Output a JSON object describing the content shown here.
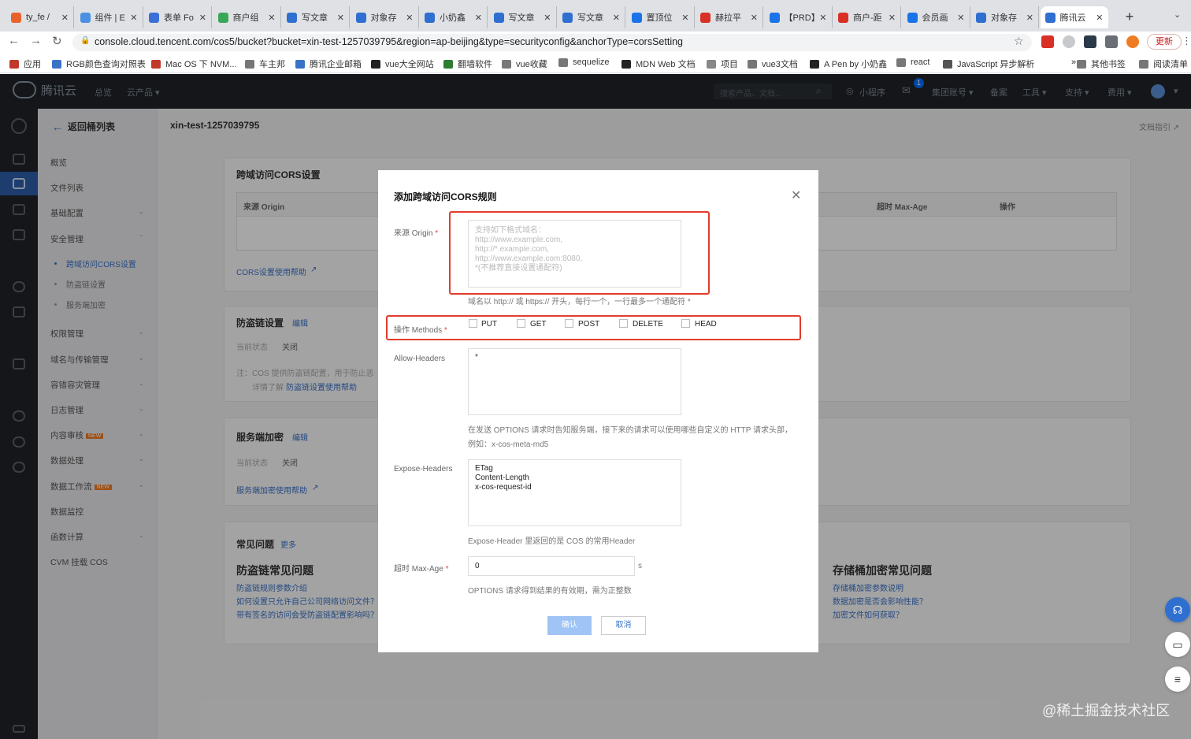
{
  "browser": {
    "tabs": [
      {
        "title": "ty_fe /",
        "color": "#e8632b"
      },
      {
        "title": "组件 | E",
        "color": "#4a90e2"
      },
      {
        "title": "表单 Fo",
        "color": "#3b6fd8"
      },
      {
        "title": "商户组",
        "color": "#3aa757"
      },
      {
        "title": "写文章",
        "color": "#2f6fd0"
      },
      {
        "title": "对象存",
        "color": "#2f6fd0"
      },
      {
        "title": "小奶鑫",
        "color": "#2f6fd0"
      },
      {
        "title": "写文章",
        "color": "#2f6fd0"
      },
      {
        "title": "写文章",
        "color": "#2f6fd0"
      },
      {
        "title": "置顶位",
        "color": "#1a73e8"
      },
      {
        "title": "赫拉平",
        "color": "#d93025"
      },
      {
        "title": "【PRD】",
        "color": "#1a73e8"
      },
      {
        "title": "商户-距",
        "color": "#d93025"
      },
      {
        "title": "会员画",
        "color": "#1a73e8"
      },
      {
        "title": "对象存",
        "color": "#2f6fd0"
      },
      {
        "title": "腾讯云",
        "color": "#2f6fd0"
      }
    ],
    "new_tab": "+",
    "url": "console.cloud.tencent.com/cos5/bucket?bucket=xin-test-1257039795&region=ap-beijing&type=securityconfig&anchorType=corsSetting",
    "update_label": "更新",
    "bookmarks": [
      {
        "label": "应用",
        "color": "#c0392b"
      },
      {
        "label": "RGB颜色查询对照表",
        "color": "#3a72c7"
      },
      {
        "label": "Mac OS 下 NVM...",
        "color": "#c0392b"
      },
      {
        "label": "车主邦",
        "color": "#777"
      },
      {
        "label": "腾讯企业邮箱",
        "color": "#3a72c7"
      },
      {
        "label": "vue大全网站",
        "color": "#222"
      },
      {
        "label": "翻墙软件",
        "color": "#2e7d32"
      },
      {
        "label": "vue收藏",
        "color": "#777"
      },
      {
        "label": "sequelize",
        "color": "#777"
      },
      {
        "label": "MDN Web 文档",
        "color": "#222"
      },
      {
        "label": "项目",
        "color": "#888"
      },
      {
        "label": "vue3文档",
        "color": "#777"
      },
      {
        "label": "A Pen by 小奶鑫",
        "color": "#222"
      },
      {
        "label": "react",
        "color": "#777"
      },
      {
        "label": "JavaScript 异步解析",
        "color": "#555"
      },
      {
        "label": "»",
        "color": "#ffffff"
      },
      {
        "label": "其他书签",
        "color": "#777"
      },
      {
        "label": "阅读清单",
        "color": "#777"
      }
    ]
  },
  "console": {
    "brand": "腾讯云",
    "nav": [
      "总览",
      "云产品 ▾"
    ],
    "search_placeholder": "搜索产品、文档...",
    "right_nav": [
      "小程序",
      "集团账号 ▾",
      "备案",
      "工具 ▾",
      "支持 ▾",
      "费用 ▾"
    ],
    "badge_count": "1"
  },
  "sidebar": {
    "back_label": "返回桶列表",
    "items": [
      {
        "label": "概览",
        "arrow": ""
      },
      {
        "label": "文件列表",
        "arrow": ""
      },
      {
        "label": "基础配置",
        "arrow": "⌄"
      },
      {
        "label": "安全管理",
        "arrow": "⌃"
      }
    ],
    "sub_items": [
      {
        "label": "跨域访问CORS设置",
        "active": true
      },
      {
        "label": "防盗链设置",
        "active": false
      },
      {
        "label": "服务端加密",
        "active": false
      }
    ],
    "items2": [
      {
        "label": "权限管理",
        "arrow": "⌄",
        "new": ""
      },
      {
        "label": "域名与传输管理",
        "arrow": "⌄",
        "new": ""
      },
      {
        "label": "容错容灾管理",
        "arrow": "⌄",
        "new": ""
      },
      {
        "label": "日志管理",
        "arrow": "⌄",
        "new": ""
      },
      {
        "label": "内容审核",
        "arrow": "⌄",
        "new": "NEW"
      },
      {
        "label": "数据处理",
        "arrow": "⌄",
        "new": ""
      },
      {
        "label": "数据工作流",
        "arrow": "⌄",
        "new": "NEW"
      },
      {
        "label": "数据监控",
        "arrow": "",
        "new": ""
      },
      {
        "label": "函数计算",
        "arrow": "⌄",
        "new": ""
      },
      {
        "label": "CVM 挂载 COS",
        "arrow": "",
        "new": ""
      }
    ]
  },
  "main": {
    "bucket_name": "xin-test-1257039795",
    "doc_guide": "文档指引 ↗",
    "cors": {
      "title": "跨域访问CORS设置",
      "col_origin": "来源 Origin",
      "col_maxage": "超时 Max-Age",
      "col_action": "操作",
      "help": "CORS设置使用帮助"
    },
    "referer": {
      "title": "防盗链设置",
      "edit": "编辑",
      "status_label": "当前状态",
      "status_value": "关闭",
      "note1": "注：COS 提供防盗链配置，用于防止恶",
      "note2": "详情了解",
      "help": "防盗链设置使用帮助"
    },
    "encrypt": {
      "title": "服务端加密",
      "edit": "编辑",
      "status_label": "当前状态",
      "status_value": "关闭",
      "help": "服务端加密使用帮助"
    },
    "faq": {
      "title": "常见问题",
      "more": "更多",
      "left_heading": "防盗链常见问题",
      "left_links": [
        "防盗链规则参数介绍",
        "如何设置只允许自己公司网络访问文件？",
        "带有签名的访问会受防盗链配置影响吗？"
      ],
      "right_heading": "存储桶加密常见问题",
      "right_links": [
        "存储桶加密参数说明",
        "数据加密是否会影响性能？",
        "加密文件如何获取？"
      ]
    }
  },
  "modal": {
    "title": "添加跨域访问CORS规则",
    "origin_label": "来源 Origin",
    "origin_placeholder": "支持如下格式域名：\nhttp://www.example.com,\nhttp://*.example.com,\nhttp://www.example.com:8080,\n*(不推荐直接设置通配符)",
    "origin_hint": "域名以 http:// 或 https:// 开头，每行一个，一行最多一个通配符 *",
    "methods_label": "操作 Methods",
    "methods": [
      "PUT",
      "GET",
      "POST",
      "DELETE",
      "HEAD"
    ],
    "allow_headers_label": "Allow-Headers",
    "allow_headers_value": "*",
    "allow_headers_hint1": "在发送 OPTIONS 请求时告知服务端，接下来的请求可以使用哪些自定义的 HTTP 请求头部，",
    "allow_headers_hint2": "例如：x-cos-meta-md5",
    "expose_headers_label": "Expose-Headers",
    "expose_headers_value": "ETag\nContent-Length\nx-cos-request-id",
    "expose_headers_hint": "Expose-Header 里返回的是 COS 的常用Header",
    "maxage_label": "超时 Max-Age",
    "maxage_value": "0",
    "maxage_unit": "s",
    "maxage_hint": "OPTIONS 请求得到结果的有效期，需为正整数",
    "ok_label": "确认",
    "cancel_label": "取消"
  },
  "watermark": "@稀土掘金技术社区"
}
